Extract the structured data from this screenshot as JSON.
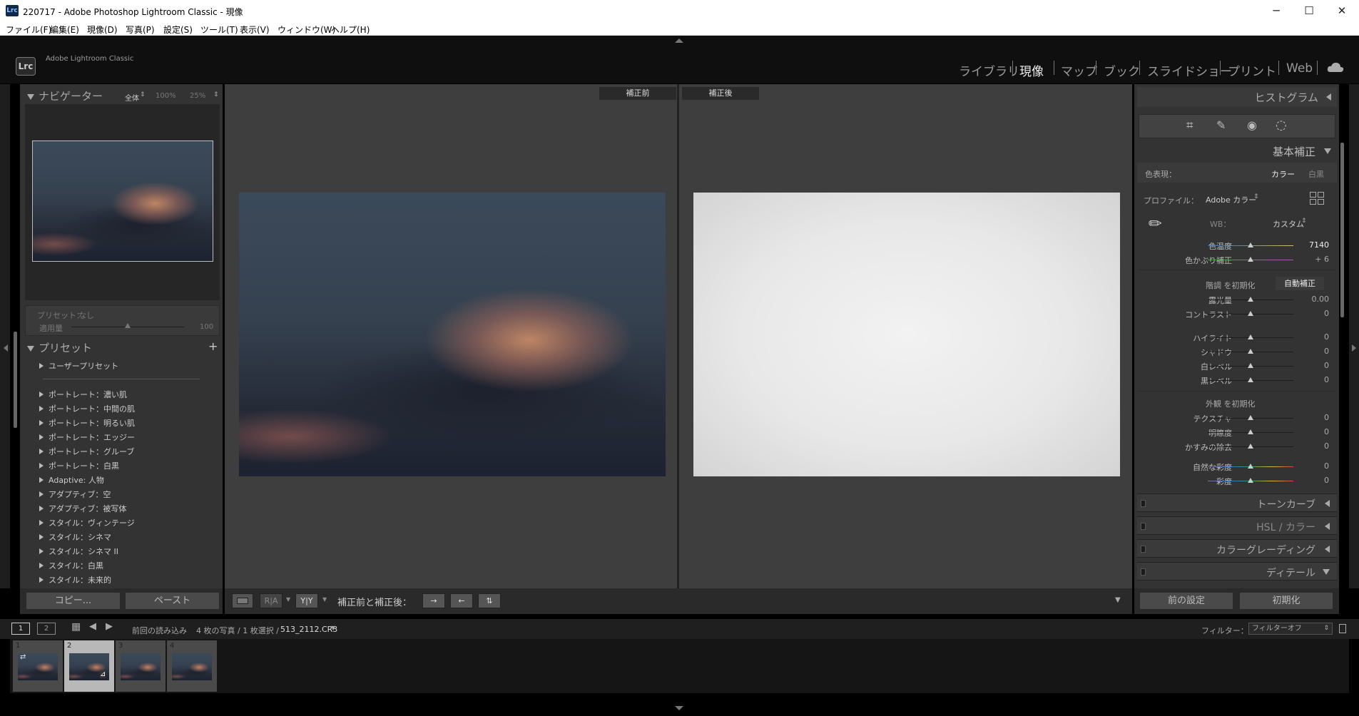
{
  "window": {
    "title": "220717 - Adobe Photoshop Lightroom Classic - 現像",
    "app_icon": "Lrc",
    "min_label": "─",
    "max_label": "☐",
    "close_label": "✕"
  },
  "menu": [
    "ファイル(F)",
    "編集(E)",
    "現像(D)",
    "写真(P)",
    "設定(S)",
    "ツール(T)",
    "表示(V)",
    "ウィンドウ(W)",
    "ヘルプ(H)"
  ],
  "header": {
    "logo": "Lrc",
    "brand": "Adobe Lightroom Classic",
    "modules": [
      "ライブラリ",
      "現像",
      "マップ",
      "ブック",
      "スライドショー",
      "プリント",
      "Web"
    ],
    "active_module": "現像"
  },
  "navigator": {
    "title": "ナビゲーター",
    "zoom_fit": "全体",
    "zoom_100": "100%",
    "zoom_25": "25%"
  },
  "preset_amount": {
    "preset_label": "プリセット：",
    "preset_value": "なし",
    "amount_label": "適用量",
    "amount_value": "100"
  },
  "presets": {
    "title": "プリセット",
    "add_icon": "+",
    "items": [
      "ユーザープリセット",
      "ポートレート：濃い肌",
      "ポートレート：中間の肌",
      "ポートレート：明るい肌",
      "ポートレート：エッジー",
      "ポートレート：グルーブ",
      "ポートレート：白黒",
      "Adaptive: 人物",
      "アダプティブ：空",
      "アダプティブ：被写体",
      "スタイル：ヴィンテージ",
      "スタイル：シネマ",
      "スタイル：シネマ II",
      "スタイル：白黒",
      "スタイル：未来的"
    ]
  },
  "left_buttons": {
    "copy": "コピー...",
    "paste": "ペースト"
  },
  "compare": {
    "before": "補正前",
    "after": "補正後"
  },
  "toolbar": {
    "before_after_label": "補正前と補正後：",
    "ra_label": "R|A",
    "yy_label": "Y|Y"
  },
  "right": {
    "histogram_title": "ヒストグラム",
    "basic_title": "基本補正",
    "treatment_label": "色表現：",
    "treatment_color": "カラー",
    "treatment_bw": "白黒",
    "profile_label": "プロファイル：",
    "profile_value": "Adobe カラー",
    "wb_label": "WB：",
    "wb_value": "カスタム",
    "temp": {
      "label": "色温度",
      "value": "7140"
    },
    "tint": {
      "label": "色かぶり補正",
      "value": "+ 6"
    },
    "tone_reset": "階調 を初期化",
    "auto_button": "自動補正",
    "tone": [
      {
        "label": "露光量",
        "value": "0.00"
      },
      {
        "label": "コントラスト",
        "value": "0"
      }
    ],
    "tone2": [
      {
        "label": "ハイライト",
        "value": "0"
      },
      {
        "label": "シャドウ",
        "value": "0"
      },
      {
        "label": "白レベル",
        "value": "0"
      },
      {
        "label": "黒レベル",
        "value": "0"
      }
    ],
    "presence_reset": "外観 を初期化",
    "presence": [
      {
        "label": "テクスチャ",
        "value": "0"
      },
      {
        "label": "明瞭度",
        "value": "0"
      },
      {
        "label": "かすみの除去",
        "value": "0"
      }
    ],
    "presence2": [
      {
        "label": "自然な彩度",
        "value": "0"
      },
      {
        "label": "彩度",
        "value": "0"
      }
    ],
    "collapsed": [
      "トーンカーブ",
      "HSL / カラー",
      "カラーグレーディング",
      "ディテール"
    ],
    "prev_button": "前の設定",
    "reset_button": "初期化"
  },
  "filmstrip": {
    "page1": "1",
    "page2": "2",
    "source": "前回の読み込み",
    "count": "4 枚の写真 / 1 枚選択 /",
    "filename": "513_2112.CR3",
    "filter_label": "フィルター：",
    "filter_value": "フィルターオフ",
    "thumbs": [
      "1",
      "2",
      "3",
      "4"
    ],
    "selected_index": 1
  }
}
